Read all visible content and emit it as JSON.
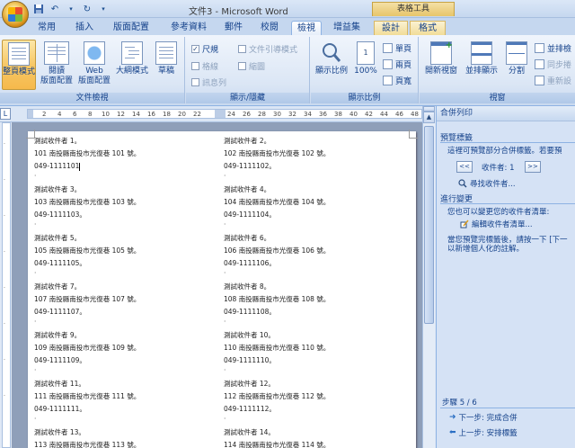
{
  "window": {
    "title": "文件3 - Microsoft Word",
    "context_tools": "表格工具"
  },
  "tabs": [
    "常用",
    "插入",
    "版面配置",
    "參考資料",
    "郵件",
    "校閱",
    "檢視",
    "增益集",
    "設計",
    "格式"
  ],
  "active_tab": "檢視",
  "ribbon": {
    "doc_views": {
      "label": "文件檢視",
      "buttons": [
        {
          "line1": "整頁模式",
          "line2": ""
        },
        {
          "line1": "閱讀",
          "line2": "版面配置"
        },
        {
          "line1": "Web",
          "line2": "版面配置"
        },
        {
          "line1": "大綱模式",
          "line2": ""
        },
        {
          "line1": "草稿",
          "line2": ""
        }
      ]
    },
    "show_hide": {
      "label": "顯示/隱藏",
      "items": [
        {
          "label": "尺規",
          "checked": true
        },
        {
          "label": "文件引導模式",
          "checked": false
        },
        {
          "label": "格線",
          "checked": false
        },
        {
          "label": "縮圖",
          "checked": false
        },
        {
          "label": "訊息列",
          "checked": false
        }
      ]
    },
    "zoom": {
      "label": "顯示比例",
      "zoom_label": "顯示比例",
      "pct_label": "100%",
      "one_page": "單頁",
      "two_pages": "兩頁",
      "page_width": "頁寬"
    },
    "window": {
      "label": "視窗",
      "new_window": "開新視窗",
      "arrange_all": "並排顯示",
      "split": "分割",
      "side_by_side": "並排檢",
      "sync_scroll": "同步捲",
      "reset_pos": "重新設"
    }
  },
  "ruler": {
    "numbers": [
      "2",
      "4",
      "6",
      "8",
      "10",
      "12",
      "14",
      "16",
      "18",
      "20",
      "22",
      "24",
      "26",
      "28",
      "30",
      "32",
      "34",
      "36",
      "38",
      "40",
      "42",
      "44",
      "46",
      "48"
    ]
  },
  "labels": [
    {
      "name": "測試收件者 1。",
      "address": "101 南投縣南投市光復巷 101 號。",
      "phone": "049-1111101"
    },
    {
      "name": "測試收件者 2。",
      "address": "102 南投縣南投市光復巷 102 號。",
      "phone": "049-1111102。"
    },
    {
      "name": "測試收件者 3。",
      "address": "103 南投縣南投市光復巷 103 號。",
      "phone": "049-1111103。"
    },
    {
      "name": "測試收件者 4。",
      "address": "104 南投縣南投市光復巷 104 號。",
      "phone": "049-1111104。"
    },
    {
      "name": "測試收件者 5。",
      "address": "105 南投縣南投市光復巷 105 號。",
      "phone": "049-1111105。"
    },
    {
      "name": "測試收件者 6。",
      "address": "106 南投縣南投市光復巷 106 號。",
      "phone": "049-1111106。"
    },
    {
      "name": "測試收件者 7。",
      "address": "107 南投縣南投市光復巷 107 號。",
      "phone": "049-1111107。"
    },
    {
      "name": "測試收件者 8。",
      "address": "108 南投縣南投市光復巷 108 號。",
      "phone": "049-1111108。"
    },
    {
      "name": "測試收件者 9。",
      "address": "109 南投縣南投市光復巷 109 號。",
      "phone": "049-1111109。"
    },
    {
      "name": "測試收件者 10。",
      "address": "110 南投縣南投市光復巷 110 號。",
      "phone": "049-1111110。"
    },
    {
      "name": "測試收件者 11。",
      "address": "111 南投縣南投市光復巷 111 號。",
      "phone": "049-1111111。"
    },
    {
      "name": "測試收件者 12。",
      "address": "112 南投縣南投市光復巷 112 號。",
      "phone": "049-1111112。"
    },
    {
      "name": "測試收件者 13。",
      "address": "113 南投縣南投市光復巷 113 號。",
      "phone": ""
    },
    {
      "name": "測試收件者 14。",
      "address": "114 南投縣南投市光復巷 114 號。",
      "phone": ""
    }
  ],
  "pane": {
    "title": "合併列印",
    "preview_heading": "預覽標籤",
    "preview_desc": "這裡可預覽部分合併標籤。若要預",
    "recipient_label": "收件者: 1",
    "prev": "<<",
    "next": ">>",
    "find_recipient": "尋找收件者...",
    "changes_heading": "進行變更",
    "changes_desc": "您也可以變更您的收件者清單:",
    "edit_list": "編輯收件者清單...",
    "after_desc1": "當您預覽完標籤後，請按一下 [下一",
    "after_desc2": "以新增個人化的註解。",
    "step": "步驟 5 / 6",
    "next_step": "下一步: 完成合併",
    "prev_step": "上一步: 安排標籤"
  }
}
